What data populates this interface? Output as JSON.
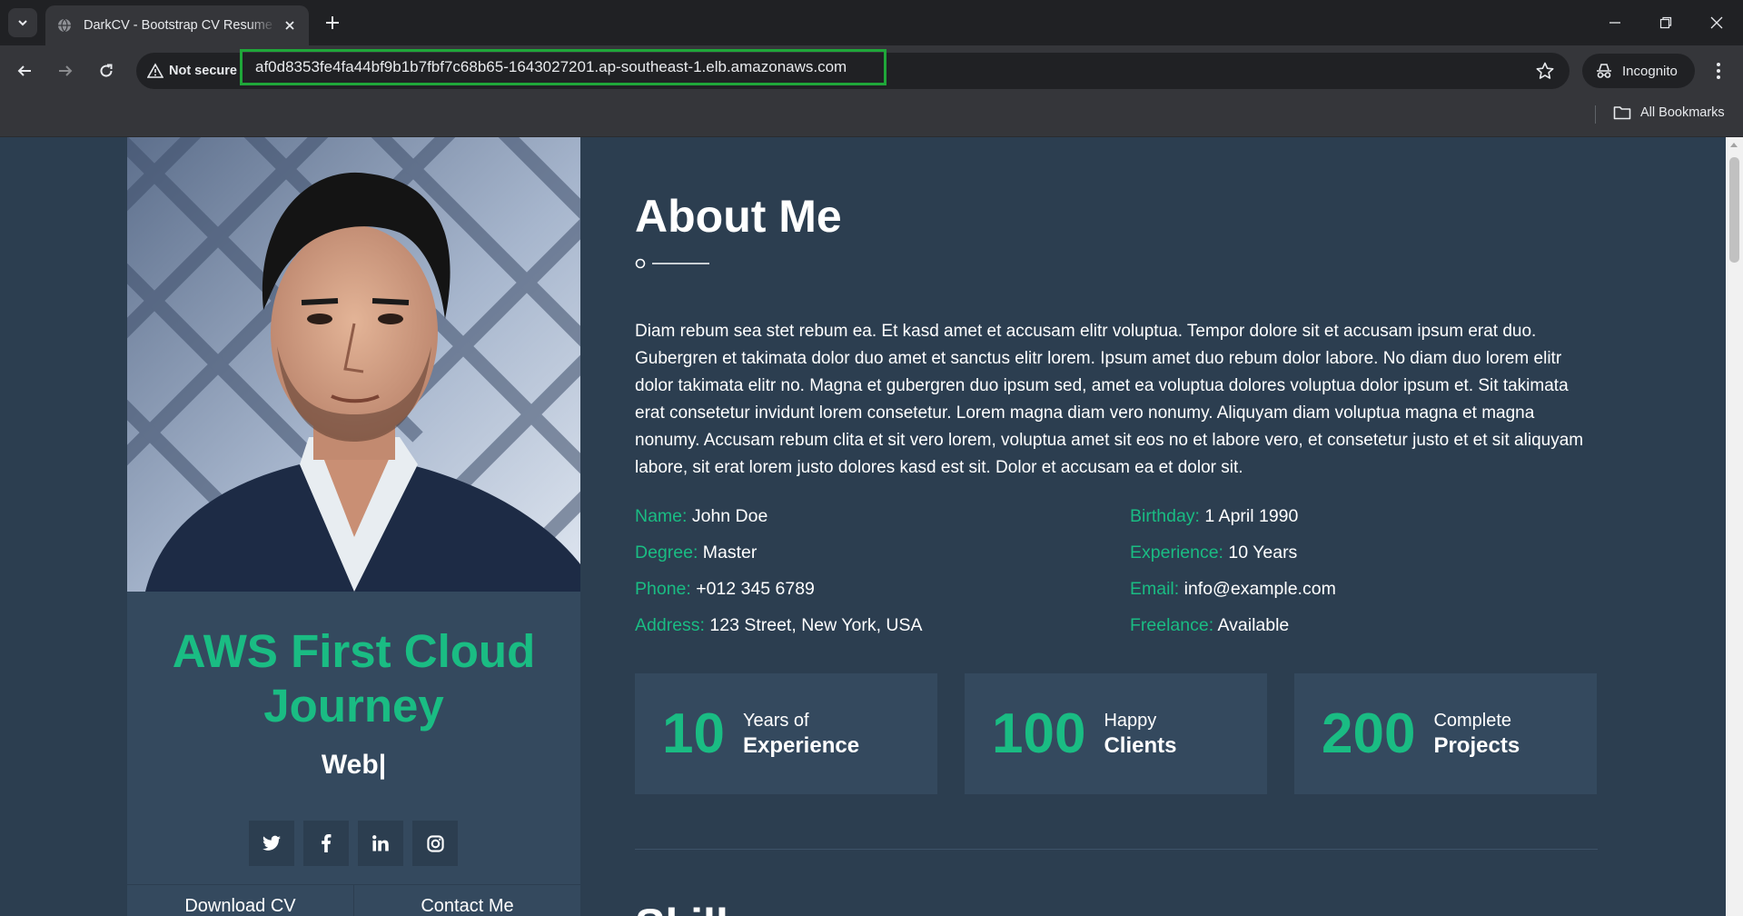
{
  "browser": {
    "tab_title": "DarkCV - Bootstrap CV Resume Template",
    "security_label": "Not secure",
    "url": "af0d8353fe4fa44bf9b1b7fbf7c68b65-1643027201.ap-southeast-1.elb.amazonaws.com",
    "incognito_label": "Incognito",
    "bookmarks_label": "All Bookmarks",
    "highlight_color": "#1fa739"
  },
  "sidebar": {
    "title": "AWS First Cloud Journey",
    "typed_text": "Web|",
    "socials": [
      {
        "icon": "twitter-icon"
      },
      {
        "icon": "facebook-icon"
      },
      {
        "icon": "linkedin-icon"
      },
      {
        "icon": "instagram-icon"
      }
    ],
    "download_label": "Download CV",
    "contact_label": "Contact Me"
  },
  "about": {
    "title": "About Me",
    "text": "Diam rebum sea stet rebum ea. Et kasd amet et accusam elitr voluptua. Tempor dolore sit et accusam ipsum erat duo. Gubergren et takimata dolor duo amet et sanctus elitr lorem. Ipsum amet duo rebum dolor labore. No diam duo lorem elitr dolor takimata elitr no. Magna et gubergren duo ipsum sed, amet ea voluptua dolores voluptua dolor ipsum et. Sit takimata erat consetetur invidunt lorem consetetur. Lorem magna diam vero nonumy. Aliquyam diam voluptua magna et magna nonumy. Accusam rebum clita et sit vero lorem, voluptua amet sit eos no et labore vero, et consetetur justo et et sit aliquyam labore, sit erat lorem justo dolores kasd est sit. Dolor et accusam ea et dolor sit.",
    "info": [
      {
        "label": "Name:",
        "value": "John Doe"
      },
      {
        "label": "Birthday:",
        "value": "1 April 1990"
      },
      {
        "label": "Degree:",
        "value": "Master"
      },
      {
        "label": "Experience:",
        "value": "10 Years"
      },
      {
        "label": "Phone:",
        "value": "+012 345 6789"
      },
      {
        "label": "Email:",
        "value": "info@example.com"
      },
      {
        "label": "Address:",
        "value": "123 Street, New York, USA"
      },
      {
        "label": "Freelance:",
        "value": "Available"
      }
    ],
    "stats": [
      {
        "number": "10",
        "line1": "Years of",
        "line2": "Experience"
      },
      {
        "number": "100",
        "line1": "Happy",
        "line2": "Clients"
      },
      {
        "number": "200",
        "line1": "Complete",
        "line2": "Projects"
      }
    ]
  },
  "next_section_title": "Skills",
  "colors": {
    "accent": "#1abc83",
    "page_bg": "#2c3e50",
    "panel_bg": "#34495e"
  }
}
